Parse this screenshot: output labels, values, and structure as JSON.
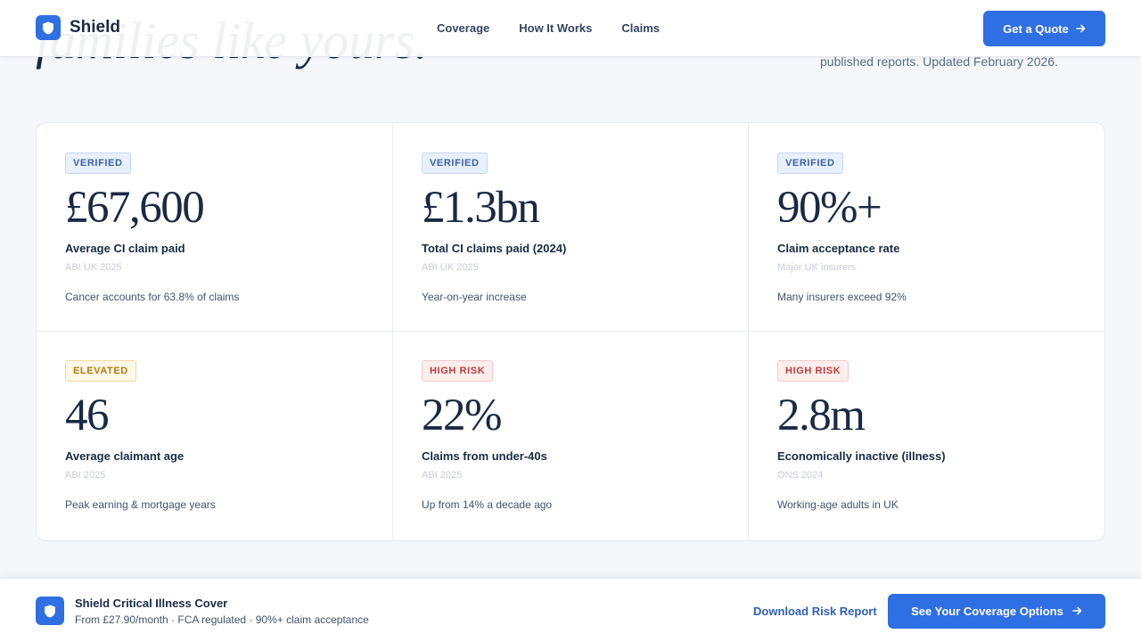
{
  "hero": {
    "heading_partial": "families like yours.",
    "note": "published reports. Updated February 2026."
  },
  "header": {
    "brand": "Shield",
    "nav": [
      "Coverage",
      "How It Works",
      "Claims"
    ],
    "cta": "Get a Quote"
  },
  "stats": [
    {
      "badge": "VERIFIED",
      "badge_type": "verified",
      "value": "£67,600",
      "label": "Average CI claim paid",
      "source": "ABI UK 2025",
      "note": "Cancer accounts for 63.8% of claims"
    },
    {
      "badge": "VERIFIED",
      "badge_type": "verified",
      "value": "£1.3bn",
      "label": "Total CI claims paid (2024)",
      "source": "ABI UK 2025",
      "note": "Year-on-year increase"
    },
    {
      "badge": "VERIFIED",
      "badge_type": "verified",
      "value": "90%+",
      "label": "Claim acceptance rate",
      "source": "Major UK insurers",
      "note": "Many insurers exceed 92%"
    },
    {
      "badge": "ELEVATED",
      "badge_type": "elevated",
      "value": "46",
      "label": "Average claimant age",
      "source": "ABI 2025",
      "note": "Peak earning & mortgage years"
    },
    {
      "badge": "HIGH RISK",
      "badge_type": "high",
      "value": "22%",
      "label": "Claims from under-40s",
      "source": "ABI 2025",
      "note": "Up from 14% a decade ago"
    },
    {
      "badge": "HIGH RISK",
      "badge_type": "high",
      "value": "2.8m",
      "label": "Economically inactive (illness)",
      "source": "ONS 2024",
      "note": "Working-age adults in UK"
    }
  ],
  "sticky": {
    "title": "Shield Critical Illness Cover",
    "subtitle": "From £27.90/month · FCA regulated · 90%+ claim acceptance",
    "download": "Download Risk Report",
    "cta": "See Your Coverage Options"
  },
  "colors": {
    "accent": "#2f6fe4",
    "navy": "#1a2a44",
    "verified": "#3b62a8",
    "elevated": "#b27a12",
    "high_risk": "#bf3b3b"
  },
  "icons": {
    "brand": "shield-icon",
    "cta": "arrow-right-icon"
  }
}
